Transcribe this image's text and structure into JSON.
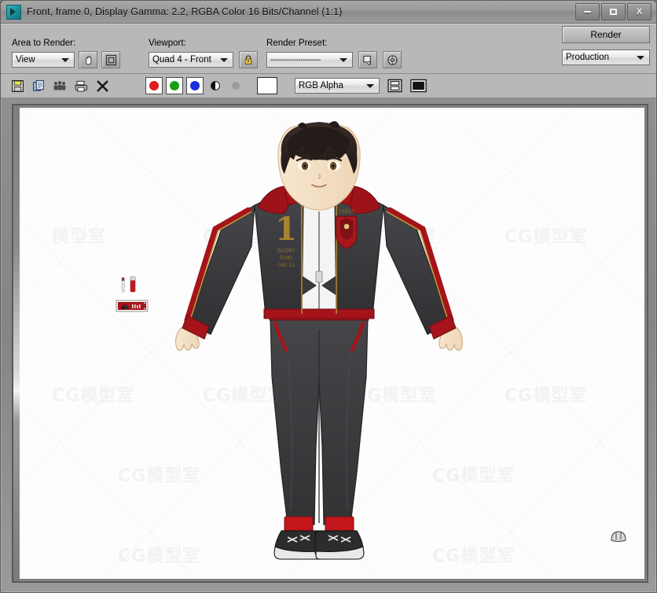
{
  "window": {
    "title": "Front, frame 0, Display Gamma: 2.2, RGBA Color 16 Bits/Channel (1:1)",
    "app_icon": "render-frame-window-icon",
    "controls": {
      "minimize": "minimize-button",
      "maximize": "maximize-button",
      "close_label": "X"
    }
  },
  "toolbar": {
    "area_to_render": {
      "label": "Area to Render:",
      "value": "View",
      "icons": [
        "pan-hand-icon",
        "region-frame-icon"
      ]
    },
    "viewport": {
      "label": "Viewport:",
      "value": "Quad 4 - Front",
      "lock_icon": "lock-icon"
    },
    "render_preset": {
      "label": "Render Preset:",
      "value": "--------------------",
      "icons": [
        "render-setup-icon",
        "environment-gear-icon"
      ]
    },
    "render_button": "Render",
    "render_mode": "Production"
  },
  "toolbar_bottom": {
    "file_icons": [
      "save-image-icon",
      "copy-image-icon",
      "clone-image-icon",
      "print-image-icon",
      "clear-image-icon"
    ],
    "channels": [
      {
        "name": "red-channel-button",
        "color": "#e01b1b"
      },
      {
        "name": "green-channel-button",
        "color": "#1a9f1a"
      },
      {
        "name": "blue-channel-button",
        "color": "#1b2fe0"
      }
    ],
    "alpha_icon": "alpha-channel-icon",
    "mono_icon": "monochrome-icon",
    "swatch_color": "#ffffff",
    "channel_display": "RGB Alpha",
    "view_icons": [
      "layout-toggle-icon",
      "display-toggle-icon"
    ]
  },
  "canvas": {
    "background": "#fdfdfd",
    "watermark_text": "CG模型室",
    "watermark_text_cn": "模型室"
  },
  "figure": {
    "name": "anime-male-character-render",
    "description": "Anime style male character, T-pose, black and red track hoodie, dark trousers, red socks, sneakers",
    "colors": {
      "skin": "#f3dcc0",
      "hair": "#2b2220",
      "jacket_dark": "#3a3a3c",
      "jacket_red": "#9e1219",
      "jacket_white": "#f4f4f4",
      "shirt": "#2b2b2d",
      "pants": "#3c3c3e",
      "sock_red": "#c3161c",
      "shoe_white": "#ededed",
      "shoe_dark": "#2a2a2a",
      "gold": "#b08a3a"
    }
  },
  "accessories": {
    "name": "small-accessory-props",
    "items": [
      "white-pen-prop",
      "red-lighter-prop",
      "red-card-badge-prop"
    ]
  }
}
